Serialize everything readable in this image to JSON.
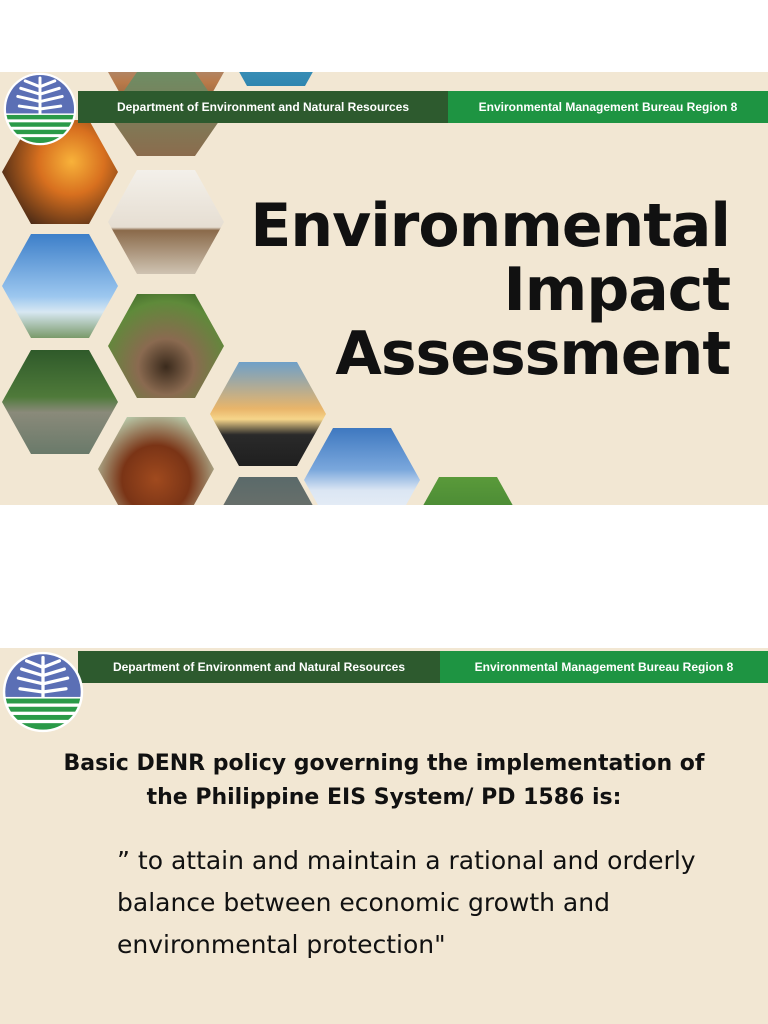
{
  "slide1": {
    "banner": {
      "department": "Department of Environment and Natural Resources",
      "bureau": "Environmental Management Bureau Region 8"
    },
    "title": {
      "line1": "Environmental",
      "line2": "Impact",
      "line3": "Assessment"
    }
  },
  "slide2": {
    "banner": {
      "department": "Department of Environment and Natural Resources",
      "bureau": "Environmental Management Bureau Region 8"
    },
    "heading": {
      "line1": "Basic DENR policy governing the implementation of",
      "line2": "the Philippine EIS System/ PD 1586 is:"
    },
    "quote": {
      "line1": "” to attain  and maintain a rational and orderly",
      "line2": "balance between economic growth and",
      "line3": "environmental protection\""
    }
  },
  "colors": {
    "background": "#f2e7d3",
    "banner_dark_green": "#2d5a2e",
    "banner_bright_green": "#1e9442",
    "logo_blue": "#5b6fb5",
    "logo_green": "#2a9a48"
  },
  "icons": [
    "denr-logo-icon"
  ]
}
